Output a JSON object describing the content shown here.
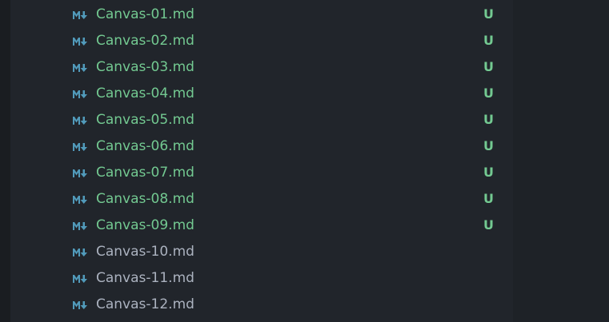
{
  "explorer": {
    "files": [
      {
        "name": "Canvas-01.md",
        "status": "U",
        "icon": "markdown-icon"
      },
      {
        "name": "Canvas-02.md",
        "status": "U",
        "icon": "markdown-icon"
      },
      {
        "name": "Canvas-03.md",
        "status": "U",
        "icon": "markdown-icon"
      },
      {
        "name": "Canvas-04.md",
        "status": "U",
        "icon": "markdown-icon"
      },
      {
        "name": "Canvas-05.md",
        "status": "U",
        "icon": "markdown-icon"
      },
      {
        "name": "Canvas-06.md",
        "status": "U",
        "icon": "markdown-icon"
      },
      {
        "name": "Canvas-07.md",
        "status": "U",
        "icon": "markdown-icon"
      },
      {
        "name": "Canvas-08.md",
        "status": "U",
        "icon": "markdown-icon"
      },
      {
        "name": "Canvas-09.md",
        "status": "U",
        "icon": "markdown-icon"
      },
      {
        "name": "Canvas-10.md",
        "status": "",
        "icon": "markdown-icon"
      },
      {
        "name": "Canvas-11.md",
        "status": "",
        "icon": "markdown-icon"
      },
      {
        "name": "Canvas-12.md",
        "status": "",
        "icon": "markdown-icon"
      }
    ]
  },
  "colors": {
    "untracked": "#73c991",
    "tracked": "#abb2bf",
    "markdown_icon": "#519aba",
    "sidebar_bg": "#21252b",
    "editor_bg": "#1e2227"
  }
}
